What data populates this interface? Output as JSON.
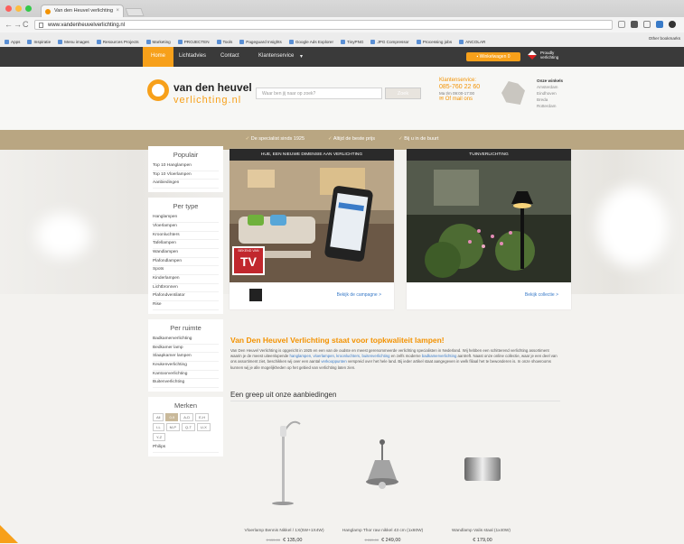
{
  "browser": {
    "tab_title": "Van den Heuvel verlichting",
    "url": "www.vandenheuvelverlichting.nl",
    "bookmarks": [
      "Apps",
      "Inspiratie",
      "Menu images",
      "Resources Projects",
      "Marketing",
      "PROJECTEN",
      "Tools",
      "Pageguard Insights",
      "Google Ads Explorer",
      "TinyPNG",
      "JPG Compressor",
      "Processing jobs",
      "ANCOLAR"
    ],
    "other_bookmarks": "Other bookmarks"
  },
  "site": {
    "nav": [
      "Home",
      "Lichtadvies",
      "Contact",
      "Klantenservice"
    ],
    "basket": "Winkelwagen",
    "basket_count": "0",
    "proudly": "Proudly\nverlichting",
    "logo_line1": "van den heuvel",
    "logo_line2": "verlichting.nl",
    "search_placeholder": "Waar ben jij naar op zoek?",
    "search_button": "Zoek",
    "service_title": "Klantenservice:",
    "service_phone": "085-760 22 60",
    "service_hours": "Ma t/m 09:00-17:00",
    "service_mail": "Of mail ons",
    "stores_title": "Onze winkels",
    "stores": [
      "Amsterdam",
      "Eindhoven",
      "Breda",
      "Rotterdam"
    ],
    "usps": [
      "De specialist sinds 1925",
      "Altijd de beste prijs",
      "Bij u in de buurt"
    ]
  },
  "sidebar": {
    "popular_title": "Populair",
    "popular": [
      "Top 10 Hanglampen",
      "Top 10 Vloerlampen",
      "Aanbiedingen"
    ],
    "type_title": "Per type",
    "types": [
      "Hanglampen",
      "Vloerlampen",
      "Kroonluchters",
      "Tafellampen",
      "Wandlampen",
      "Plafondlampen",
      "Spots",
      "Kinderlampen",
      "Lichtbronnen",
      "Plafondventilator",
      "Rise"
    ],
    "room_title": "Per ruimte",
    "rooms": [
      "Badkamerverlichting",
      "Bedkamer lamp",
      "Slaapkamer lampen",
      "Keukenverlichting",
      "Kantoorverlichting",
      "Buitenverlichting"
    ],
    "brands_title": "Merken",
    "alpha": [
      "All",
      "0-9",
      "A-D",
      "E-H",
      "I-L",
      "M-P",
      "Q-T",
      "U-X",
      "Y-Z"
    ],
    "alpha_selected": "0-9",
    "brand_first": "Philips"
  },
  "cards": [
    {
      "caption": "HUE, EEN NIEUWE DIMENSIE AAN VERLICHTING",
      "link": "Bekijk de campagne >",
      "badge_top": "BEKEND VAN",
      "badge_tv": "TV"
    },
    {
      "caption": "TUINVERLICHTING",
      "link": "Bekijk collectie >"
    }
  ],
  "intro": {
    "title": "Van Den Heuvel Verlichting staat voor topkwaliteit lampen!",
    "text_a": "Van Den Heuvel Verlichting is opgericht in 1925 en een van de oudste en meest gerenommeerde verlichting specialisten in Nederland. Wij hebben een schitterend verlichting assortiment waarin je de meest uiteenlopende ",
    "link_a": "hanglampen, vloerlampen, kroonluchters, buitenverlichting",
    "text_b": " en zelfs moderne ",
    "link_b": "badkamerverlichting",
    "text_c": " aantreft. Naast onze online collectie, waar je een deel van ons assortiment ziet, beschikken wij over een aantal ",
    "link_c": "verkooppunten",
    "text_d": " verspreid over het hele land. Bij ieder artikel staat aangegeven in welk filiaal het te bewonderen is. In onze showrooms kunnen wij je alle mogelijkheden op het gebied van verlichting laten zien."
  },
  "offers_title": "Een greep uit onze aanbiedingen",
  "products": [
    {
      "name": "Vloerlamp Bennis Nikkel / 1X(5W+1X4W)",
      "old": "€ 155,00",
      "price": "€ 135,00"
    },
    {
      "name": "Hanglamp Thor raw nikkel 43 cm (1x60W)",
      "old": "€ 285,00",
      "price": "€ 249,00"
    },
    {
      "name": "Wandlamp Valis staal (1x40W)",
      "old": "",
      "price": "€ 179,00"
    }
  ]
}
